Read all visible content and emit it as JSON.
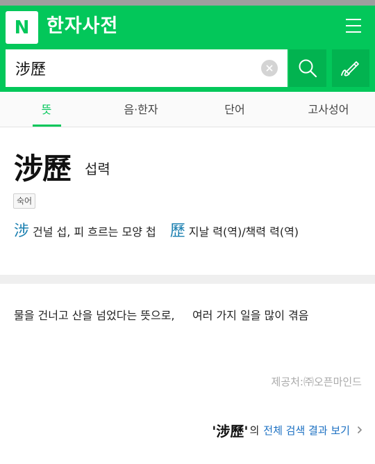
{
  "header": {
    "logo_text": "N",
    "title": "한자사전",
    "menu_icon": "hamburger-menu-icon",
    "brand_color": "#03c75a"
  },
  "search": {
    "query": "涉歷",
    "clear_icon": "close-icon",
    "search_icon": "search-icon",
    "write_icon": "handwriting-pen-icon"
  },
  "tabs": [
    {
      "label": "뜻",
      "active": true
    },
    {
      "label": "음·한자",
      "active": false
    },
    {
      "label": "단어",
      "active": false
    },
    {
      "label": "고사성어",
      "active": false
    }
  ],
  "entry": {
    "word": "涉歷",
    "reading": "섭력",
    "badge": "숙어",
    "characters": [
      {
        "char": "涉",
        "meaning": "건널 섭, 피 흐르는 모양 첩"
      },
      {
        "char": "歷",
        "meaning": "지날 력(역)/책력 력(역)"
      }
    ],
    "definition": "물을 건너고 산을 넘었다는 뜻으로,     여러 가지 일을 많이 겪음",
    "source": "제공처:㈜오픈마인드"
  },
  "full_search": {
    "term": "'涉歷'",
    "particle": "의",
    "link_text": "전체 검색 결과 보기",
    "icon": "chevron-right-icon"
  }
}
